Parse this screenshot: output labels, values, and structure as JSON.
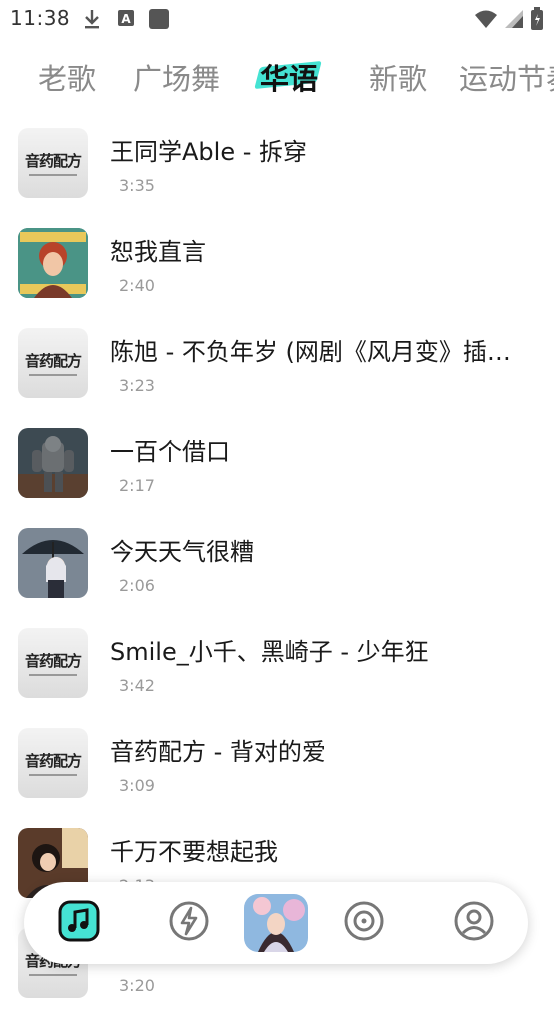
{
  "status_bar": {
    "time": "11:38",
    "left_icons": [
      "download-icon",
      "app-a-icon",
      "square-icon"
    ],
    "right_icons": [
      "wifi-icon",
      "signal-icon",
      "battery-icon"
    ]
  },
  "tabs": [
    {
      "label": "老歌",
      "active": false
    },
    {
      "label": "广场舞",
      "active": false
    },
    {
      "label": "华语",
      "active": true
    },
    {
      "label": "新歌",
      "active": false
    },
    {
      "label": "运动节奏",
      "active": false
    }
  ],
  "colors": {
    "accent": "#45e3d3",
    "tab_inactive": "#8a8a8a",
    "duration": "#9a9a9a"
  },
  "songs": [
    {
      "title": "王同学Able - 拆穿",
      "duration": "3:35",
      "cover": "brand-cover"
    },
    {
      "title": "恕我直言",
      "duration": "2:40",
      "cover": "anime-girl-cover"
    },
    {
      "title": "陈旭 - 不负年岁 (网剧《风月变》插曲)",
      "duration": "3:23",
      "cover": "brand-cover"
    },
    {
      "title": "一百个借口",
      "duration": "2:17",
      "cover": "robot-cover"
    },
    {
      "title": "今天天气很糟",
      "duration": "2:06",
      "cover": "umbrella-girl-cover"
    },
    {
      "title": "Smile_小千、黑崎子 - 少年狂",
      "duration": "3:42",
      "cover": "brand-cover"
    },
    {
      "title": "音药配方 - 背对的爱",
      "duration": "3:09",
      "cover": "brand-cover"
    },
    {
      "title": "千万不要想起我",
      "duration": "2:13",
      "cover": "reading-girl-cover"
    },
    {
      "title": "",
      "duration": "3:20",
      "cover": "brand-cover"
    }
  ],
  "brand_cover_text": "音药配方",
  "bottom_nav": {
    "items": [
      "music-note-icon",
      "lightning-icon",
      "now-playing-cover",
      "disc-icon",
      "profile-icon"
    ]
  }
}
